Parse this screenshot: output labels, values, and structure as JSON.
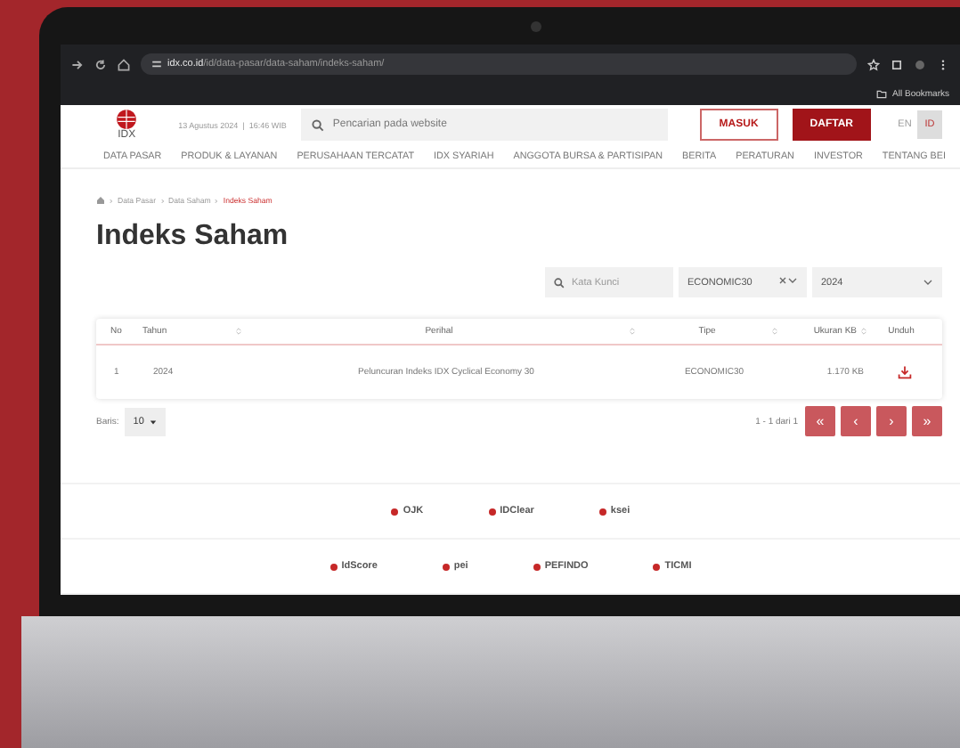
{
  "browser": {
    "url_host": "idx.co.id",
    "url_path": "/id/data-pasar/data-saham/indeks-saham/",
    "bookmarks": "All Bookmarks"
  },
  "header": {
    "logo": "IDX",
    "datetime": "13 Agustus 2024  |  16:46 WIB",
    "search_placeholder": "Pencarian pada website",
    "login": "MASUK",
    "register": "DAFTAR",
    "languages": [
      {
        "label": "EN",
        "selected": false
      },
      {
        "label": "ID",
        "selected": true
      }
    ]
  },
  "nav": [
    "DATA PASAR",
    "PRODUK & LAYANAN",
    "PERUSAHAAN TERCATAT",
    "IDX SYARIAH",
    "ANGGOTA BURSA & PARTISIPAN",
    "BERITA",
    "PERATURAN",
    "INVESTOR",
    "TENTANG BEI"
  ],
  "breadcrumb": [
    "Data Pasar",
    "Data Saham",
    "Indeks Saham"
  ],
  "title": "Indeks Saham",
  "filters": {
    "keyword_placeholder": "Kata Kunci",
    "index": "ECONOMIC30",
    "year": "2024"
  },
  "table": {
    "columns": [
      {
        "label": "No",
        "sortable": false
      },
      {
        "label": "Tahun",
        "sortable": true
      },
      {
        "label": "Perihal",
        "sortable": true
      },
      {
        "label": "Tipe",
        "sortable": true
      },
      {
        "label": "Ukuran KB",
        "sortable": true
      },
      {
        "label": "Unduh",
        "sortable": false
      }
    ],
    "rows": [
      [
        "1",
        "2024",
        "Peluncuran Indeks IDX Cyclical Economy 30",
        "ECONOMIC30",
        "1.170 KB"
      ]
    ]
  },
  "pagination": {
    "rows_label": "Baris:",
    "page_size": "10",
    "range": "1 - 1 dari 1",
    "buttons": [
      "«",
      "‹",
      "›",
      "»"
    ]
  },
  "footer": {
    "logo_rows": [
      [
        "OJK",
        "IDClear",
        "ksei"
      ],
      [
        "IdScore",
        "pei",
        "PEFINDO",
        "TICMI"
      ]
    ]
  }
}
